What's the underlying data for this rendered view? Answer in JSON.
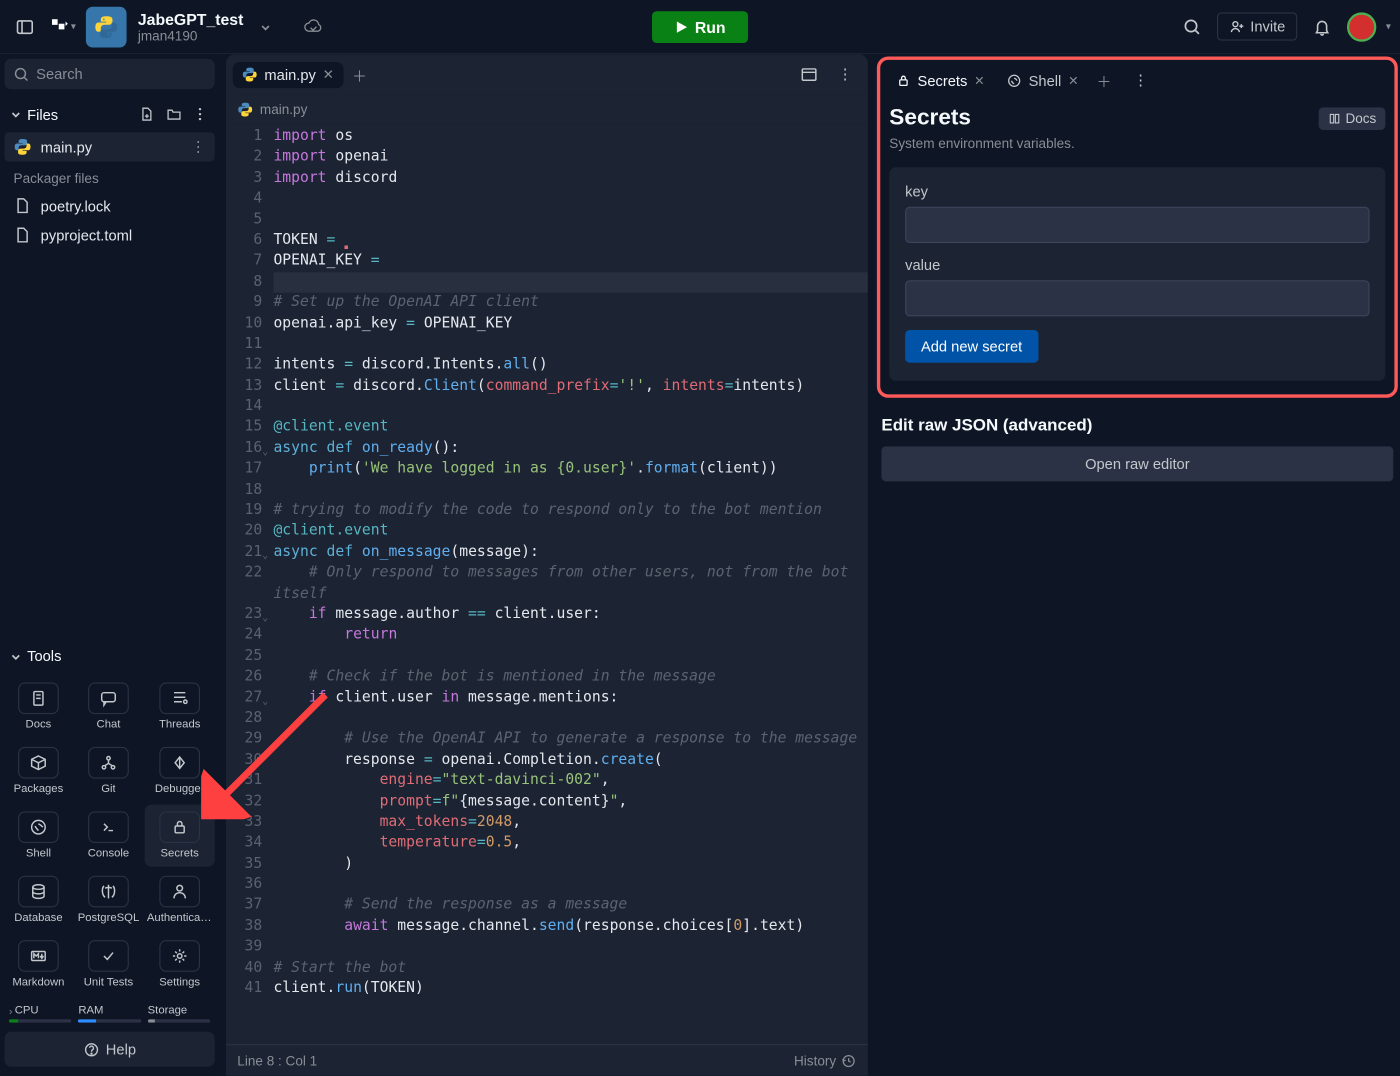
{
  "project": {
    "title": "JabeGPT_test",
    "user": "jman4190"
  },
  "run_label": "Run",
  "invite_label": "Invite",
  "search_placeholder": "Search",
  "files_label": "Files",
  "active_file": "main.py",
  "packager_label": "Packager files",
  "packager_files": [
    "poetry.lock",
    "pyproject.toml"
  ],
  "tools_label": "Tools",
  "tools": [
    "Docs",
    "Chat",
    "Threads",
    "Packages",
    "Git",
    "Debugger",
    "Shell",
    "Console",
    "Secrets",
    "Database",
    "PostgreSQL",
    "Authenticati...",
    "Markdown",
    "Unit Tests",
    "Settings"
  ],
  "stats": {
    "cpu": "CPU",
    "ram": "RAM",
    "storage": "Storage"
  },
  "help_label": "Help",
  "editor_tab": "main.py",
  "breadcrumb_file": "main.py",
  "status": {
    "position": "Line 8 : Col 1",
    "history": "History"
  },
  "code_lines": [
    {
      "n": 1,
      "html": "<span class='tok-kw2'>import</span> <span class='tok-mod'>os</span>"
    },
    {
      "n": 2,
      "html": "<span class='tok-kw2'>import</span> <span class='tok-mod'>openai</span>"
    },
    {
      "n": 3,
      "html": "<span class='tok-kw2'>import</span> <span class='tok-mod'>discord</span>"
    },
    {
      "n": 4,
      "html": ""
    },
    {
      "n": 5,
      "html": ""
    },
    {
      "n": 6,
      "html": "TOKEN <span class='tok-op'>=</span> <span class='err-dot' style='left:62px'>▪</span>"
    },
    {
      "n": 7,
      "html": "OPENAI_KEY <span class='tok-op'>=</span> "
    },
    {
      "n": 8,
      "html": "",
      "active": true
    },
    {
      "n": 9,
      "html": "<span class='tok-com'># Set up the OpenAI API client</span>"
    },
    {
      "n": 10,
      "html": "openai.api_key <span class='tok-op'>=</span> OPENAI_KEY"
    },
    {
      "n": 11,
      "html": ""
    },
    {
      "n": 12,
      "html": "intents <span class='tok-op'>=</span> discord.Intents.<span class='tok-fn'>all</span>()"
    },
    {
      "n": 13,
      "html": "client <span class='tok-op'>=</span> discord.<span class='tok-fn'>Client</span>(<span class='tok-self'>command_prefix</span><span class='tok-op'>=</span><span class='tok-str'>'!'</span>, <span class='tok-self'>intents</span><span class='tok-op'>=</span>intents)"
    },
    {
      "n": 14,
      "html": ""
    },
    {
      "n": 15,
      "html": "<span class='tok-dec'>@client.event</span>"
    },
    {
      "n": 16,
      "html": "<span class='fold'>⌄</span><span class='tok-kw'>async</span> <span class='tok-kw'>def</span> <span class='tok-fn'>on_ready</span>():"
    },
    {
      "n": 17,
      "html": "    <span class='tok-fn'>print</span>(<span class='tok-str'>'We have logged in as {0.user}'</span>.<span class='tok-fn'>format</span>(client))"
    },
    {
      "n": 18,
      "html": ""
    },
    {
      "n": 19,
      "html": "<span class='tok-com'># trying to modify the code to respond only to the bot mention</span>"
    },
    {
      "n": 20,
      "html": "<span class='tok-dec'>@client.event</span>"
    },
    {
      "n": 21,
      "html": "<span class='fold'>⌄</span><span class='tok-kw'>async</span> <span class='tok-kw'>def</span> <span class='tok-fn'>on_message</span>(message):"
    },
    {
      "n": 22,
      "html": "    <span class='tok-com'># Only respond to messages from other users, not from the bot<br>itself</span>",
      "h": 2
    },
    {
      "n": 23,
      "html": "<span class='fold'>⌄</span>    <span class='tok-kw2'>if</span> message.author <span class='tok-op'>==</span> client.user:"
    },
    {
      "n": 24,
      "html": "        <span class='tok-kw2'>return</span>"
    },
    {
      "n": 25,
      "html": ""
    },
    {
      "n": 26,
      "html": "    <span class='tok-com'># Check if the bot is mentioned in the message</span>"
    },
    {
      "n": 27,
      "html": "<span class='fold'>⌄</span>    <span class='tok-kw2'>if</span> client.user <span class='tok-kw2'>in</span> message.mentions:"
    },
    {
      "n": 28,
      "html": ""
    },
    {
      "n": 29,
      "html": "        <span class='tok-com'># Use the OpenAI API to generate a response to the message</span>"
    },
    {
      "n": 30,
      "html": "        response <span class='tok-op'>=</span> openai.Completion.<span class='tok-fn'>create</span>("
    },
    {
      "n": 31,
      "html": "            <span class='tok-self'>engine</span><span class='tok-op'>=</span><span class='tok-str'>\"text-davinci-002\"</span>,"
    },
    {
      "n": 32,
      "html": "            <span class='tok-self'>prompt</span><span class='tok-op'>=</span><span class='tok-str'>f\"</span>{message.content}<span class='tok-str'>\"</span>,"
    },
    {
      "n": 33,
      "html": "            <span class='tok-self'>max_tokens</span><span class='tok-op'>=</span><span class='tok-num'>2048</span>,"
    },
    {
      "n": 34,
      "html": "            <span class='tok-self'>temperature</span><span class='tok-op'>=</span><span class='tok-num'>0.5</span>,"
    },
    {
      "n": 35,
      "html": "        )"
    },
    {
      "n": 36,
      "html": ""
    },
    {
      "n": 37,
      "html": "        <span class='tok-com'># Send the response as a message</span>"
    },
    {
      "n": 38,
      "html": "        <span class='tok-kw2'>await</span> message.channel.<span class='tok-fn'>send</span>(response.choices[<span class='tok-num'>0</span>].text)"
    },
    {
      "n": 39,
      "html": ""
    },
    {
      "n": 40,
      "html": "<span class='tok-com'># Start the bot</span>"
    },
    {
      "n": 41,
      "html": "client.<span class='tok-fn'>run</span>(TOKEN)"
    }
  ],
  "right_tabs": [
    {
      "label": "Secrets",
      "icon": "lock",
      "active": true
    },
    {
      "label": "Shell",
      "icon": "shell",
      "active": false
    }
  ],
  "secrets": {
    "title": "Secrets",
    "subtitle": "System environment variables.",
    "docs_label": "Docs",
    "key_label": "key",
    "value_label": "value",
    "add_label": "Add new secret"
  },
  "json_section": {
    "title": "Edit raw JSON (advanced)",
    "button": "Open raw editor"
  }
}
